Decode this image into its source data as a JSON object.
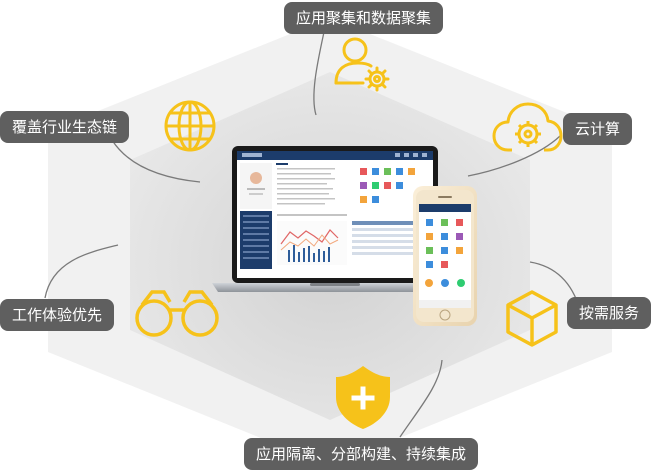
{
  "labels": {
    "top": "应用聚集和数据聚集",
    "left_upper": "覆盖行业生态链",
    "right_upper": "云计算",
    "left_lower": "工作体验优先",
    "right_lower": "按需服务",
    "bottom": "应用隔离、分部构建、持续集成"
  },
  "icons": {
    "top": "user-gear-icon",
    "left_upper": "globe-icon",
    "right_upper": "cloud-gear-icon",
    "left_lower": "binoculars-icon",
    "right_lower": "cube-icon",
    "bottom": "shield-plus-icon"
  },
  "colors": {
    "accent": "#f6c21a",
    "label_bg": "#5f5f5f",
    "hex_outer": "#f1f1f1",
    "hex_inner": "#dcdcdc",
    "connector": "#7a7a7a",
    "screen_header": "#1c3c6b"
  }
}
